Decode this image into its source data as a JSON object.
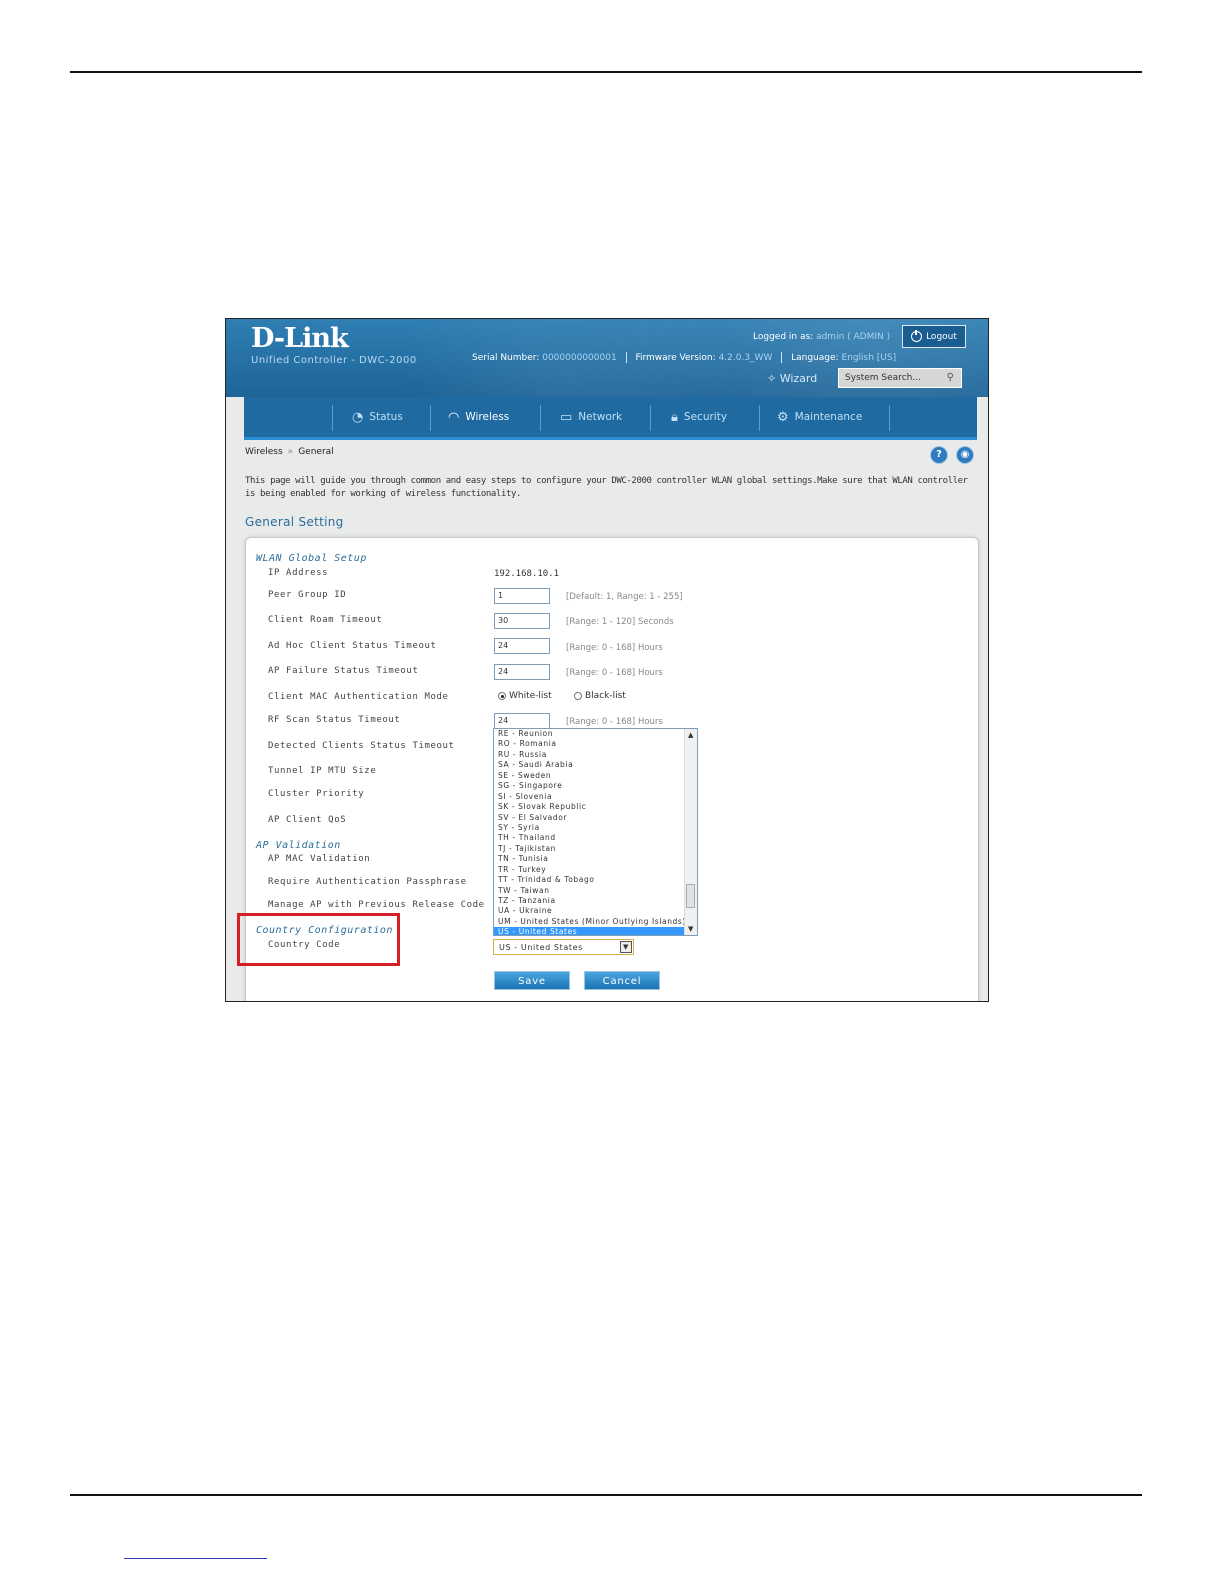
{
  "header": {
    "logo": "D-Link",
    "subtitle": "Unified Controller - DWC-2000",
    "logged_in_label": "Logged in as:",
    "logged_in_user": "admin ( ADMIN )",
    "logout_label": "Logout",
    "serial_label": "Serial Number:",
    "serial_value": "0000000000001",
    "firmware_label": "Firmware Version:",
    "firmware_value": "4.2.0.3_WW",
    "language_label": "Language:",
    "language_value": "English [US]",
    "wizard_label": "Wizard",
    "search_placeholder": "System Search..."
  },
  "nav": {
    "items": [
      {
        "label": "Status",
        "icon": "gauge-icon"
      },
      {
        "label": "Wireless",
        "icon": "wifi-icon"
      },
      {
        "label": "Network",
        "icon": "monitor-icon"
      },
      {
        "label": "Security",
        "icon": "lock-icon"
      },
      {
        "label": "Maintenance",
        "icon": "gears-icon"
      }
    ],
    "active": "Wireless"
  },
  "breadcrumb": {
    "parent": "Wireless",
    "separator": "»",
    "current": "General"
  },
  "description": "This page will guide you through common and easy steps to configure your DWC-2000 controller WLAN global settings.Make sure that WLAN controller is being enabled for working of wireless functionality.",
  "section_title": "General Setting",
  "wlan_global": {
    "title": "WLAN Global Setup",
    "ip_label": "IP Address",
    "ip_value": "192.168.10.1",
    "peer_group_label": "Peer Group ID",
    "peer_group_value": "1",
    "peer_group_hint": "[Default: 1, Range: 1 - 255]",
    "roam_label": "Client Roam Timeout",
    "roam_value": "30",
    "roam_hint": "[Range: 1 - 120] Seconds",
    "adhoc_label": "Ad Hoc Client Status Timeout",
    "adhoc_value": "24",
    "adhoc_hint": "[Range: 0 - 168] Hours",
    "apfail_label": "AP Failure Status Timeout",
    "apfail_value": "24",
    "apfail_hint": "[Range: 0 - 168] Hours",
    "mac_mode_label": "Client MAC Authentication Mode",
    "mac_mode_white": "White-list",
    "mac_mode_black": "Black-list",
    "rfscan_label": "RF Scan Status Timeout",
    "rfscan_value": "24",
    "rfscan_hint": "[Range: 0 - 168] Hours",
    "detected_label": "Detected Clients Status Timeout",
    "tunnel_label": "Tunnel IP MTU Size",
    "cluster_label": "Cluster Priority",
    "qos_label": "AP Client QoS"
  },
  "ap_validation": {
    "title": "AP Validation",
    "mac_label": "AP MAC Validation",
    "passphrase_label": "Require Authentication Passphrase",
    "manage_label": "Manage AP with Previous Release Code"
  },
  "country": {
    "title": "Country Configuration",
    "code_label": "Country Code",
    "selected": "US - United States",
    "options": [
      "RE - Reunion",
      "RO - Romania",
      "RU - Russia",
      "SA - Saudi Arabia",
      "SE - Sweden",
      "SG - Singapore",
      "SI - Slovenia",
      "SK - Slovak Republic",
      "SV - El Salvador",
      "SY - Syria",
      "TH - Thailand",
      "TJ - Tajikistan",
      "TN - Tunisia",
      "TR - Turkey",
      "TT - Trinidad & Tobago",
      "TW - Taiwan",
      "TZ - Tanzania",
      "UA - Ukraine",
      "UM - United States (Minor Outlying Islands)",
      "US - United States"
    ]
  },
  "buttons": {
    "save": "Save",
    "cancel": "Cancel"
  },
  "colors": {
    "highlight": "#d41f26",
    "header": "#1d6498",
    "accent": "#2a6e9a",
    "selected": "#3399ff"
  }
}
